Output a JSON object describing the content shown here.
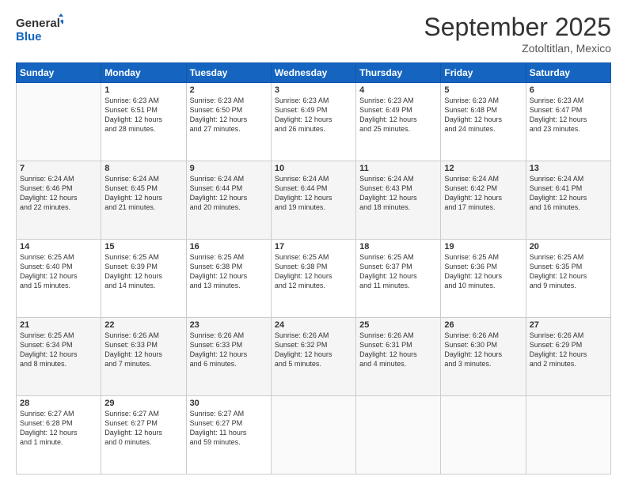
{
  "header": {
    "logo_general": "General",
    "logo_blue": "Blue",
    "month_title": "September 2025",
    "subtitle": "Zotoltitlan, Mexico"
  },
  "days_of_week": [
    "Sunday",
    "Monday",
    "Tuesday",
    "Wednesday",
    "Thursday",
    "Friday",
    "Saturday"
  ],
  "weeks": [
    [
      {
        "day": "",
        "info": ""
      },
      {
        "day": "1",
        "info": "Sunrise: 6:23 AM\nSunset: 6:51 PM\nDaylight: 12 hours\nand 28 minutes."
      },
      {
        "day": "2",
        "info": "Sunrise: 6:23 AM\nSunset: 6:50 PM\nDaylight: 12 hours\nand 27 minutes."
      },
      {
        "day": "3",
        "info": "Sunrise: 6:23 AM\nSunset: 6:49 PM\nDaylight: 12 hours\nand 26 minutes."
      },
      {
        "day": "4",
        "info": "Sunrise: 6:23 AM\nSunset: 6:49 PM\nDaylight: 12 hours\nand 25 minutes."
      },
      {
        "day": "5",
        "info": "Sunrise: 6:23 AM\nSunset: 6:48 PM\nDaylight: 12 hours\nand 24 minutes."
      },
      {
        "day": "6",
        "info": "Sunrise: 6:23 AM\nSunset: 6:47 PM\nDaylight: 12 hours\nand 23 minutes."
      }
    ],
    [
      {
        "day": "7",
        "info": "Sunrise: 6:24 AM\nSunset: 6:46 PM\nDaylight: 12 hours\nand 22 minutes."
      },
      {
        "day": "8",
        "info": "Sunrise: 6:24 AM\nSunset: 6:45 PM\nDaylight: 12 hours\nand 21 minutes."
      },
      {
        "day": "9",
        "info": "Sunrise: 6:24 AM\nSunset: 6:44 PM\nDaylight: 12 hours\nand 20 minutes."
      },
      {
        "day": "10",
        "info": "Sunrise: 6:24 AM\nSunset: 6:44 PM\nDaylight: 12 hours\nand 19 minutes."
      },
      {
        "day": "11",
        "info": "Sunrise: 6:24 AM\nSunset: 6:43 PM\nDaylight: 12 hours\nand 18 minutes."
      },
      {
        "day": "12",
        "info": "Sunrise: 6:24 AM\nSunset: 6:42 PM\nDaylight: 12 hours\nand 17 minutes."
      },
      {
        "day": "13",
        "info": "Sunrise: 6:24 AM\nSunset: 6:41 PM\nDaylight: 12 hours\nand 16 minutes."
      }
    ],
    [
      {
        "day": "14",
        "info": "Sunrise: 6:25 AM\nSunset: 6:40 PM\nDaylight: 12 hours\nand 15 minutes."
      },
      {
        "day": "15",
        "info": "Sunrise: 6:25 AM\nSunset: 6:39 PM\nDaylight: 12 hours\nand 14 minutes."
      },
      {
        "day": "16",
        "info": "Sunrise: 6:25 AM\nSunset: 6:38 PM\nDaylight: 12 hours\nand 13 minutes."
      },
      {
        "day": "17",
        "info": "Sunrise: 6:25 AM\nSunset: 6:38 PM\nDaylight: 12 hours\nand 12 minutes."
      },
      {
        "day": "18",
        "info": "Sunrise: 6:25 AM\nSunset: 6:37 PM\nDaylight: 12 hours\nand 11 minutes."
      },
      {
        "day": "19",
        "info": "Sunrise: 6:25 AM\nSunset: 6:36 PM\nDaylight: 12 hours\nand 10 minutes."
      },
      {
        "day": "20",
        "info": "Sunrise: 6:25 AM\nSunset: 6:35 PM\nDaylight: 12 hours\nand 9 minutes."
      }
    ],
    [
      {
        "day": "21",
        "info": "Sunrise: 6:25 AM\nSunset: 6:34 PM\nDaylight: 12 hours\nand 8 minutes."
      },
      {
        "day": "22",
        "info": "Sunrise: 6:26 AM\nSunset: 6:33 PM\nDaylight: 12 hours\nand 7 minutes."
      },
      {
        "day": "23",
        "info": "Sunrise: 6:26 AM\nSunset: 6:33 PM\nDaylight: 12 hours\nand 6 minutes."
      },
      {
        "day": "24",
        "info": "Sunrise: 6:26 AM\nSunset: 6:32 PM\nDaylight: 12 hours\nand 5 minutes."
      },
      {
        "day": "25",
        "info": "Sunrise: 6:26 AM\nSunset: 6:31 PM\nDaylight: 12 hours\nand 4 minutes."
      },
      {
        "day": "26",
        "info": "Sunrise: 6:26 AM\nSunset: 6:30 PM\nDaylight: 12 hours\nand 3 minutes."
      },
      {
        "day": "27",
        "info": "Sunrise: 6:26 AM\nSunset: 6:29 PM\nDaylight: 12 hours\nand 2 minutes."
      }
    ],
    [
      {
        "day": "28",
        "info": "Sunrise: 6:27 AM\nSunset: 6:28 PM\nDaylight: 12 hours\nand 1 minute."
      },
      {
        "day": "29",
        "info": "Sunrise: 6:27 AM\nSunset: 6:27 PM\nDaylight: 12 hours\nand 0 minutes."
      },
      {
        "day": "30",
        "info": "Sunrise: 6:27 AM\nSunset: 6:27 PM\nDaylight: 11 hours\nand 59 minutes."
      },
      {
        "day": "",
        "info": ""
      },
      {
        "day": "",
        "info": ""
      },
      {
        "day": "",
        "info": ""
      },
      {
        "day": "",
        "info": ""
      }
    ]
  ]
}
